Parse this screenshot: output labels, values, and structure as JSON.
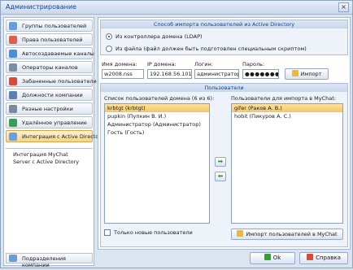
{
  "window": {
    "title": "Администрирование",
    "close_glyph": "×"
  },
  "sidebar": {
    "items": [
      {
        "label": "Группы пользователей",
        "icon": "users-group-icon",
        "color": "#6b9bd8"
      },
      {
        "label": "Права пользователей",
        "icon": "rights-icon",
        "color": "#e05c4b"
      },
      {
        "label": "Автосоздаваемые каналы",
        "icon": "channels-icon",
        "color": "#4a8fd6"
      },
      {
        "label": "Операторы каналов",
        "icon": "operators-icon",
        "color": "#7d8da6"
      },
      {
        "label": "Забаненные пользователи",
        "icon": "banned-icon",
        "color": "#d84a3a"
      },
      {
        "label": "Должности компании",
        "icon": "positions-icon",
        "color": "#5b7fb3"
      },
      {
        "label": "Разные настройки",
        "icon": "settings-icon",
        "color": "#7a8aa0"
      },
      {
        "label": "Удалённое управление",
        "icon": "remote-icon",
        "color": "#3d9c5a"
      },
      {
        "label": "Интеграция с Active Directory",
        "icon": "ad-icon",
        "color": "#6f9fd6"
      }
    ],
    "panel_text": "Интеграция MyChat Server с Active Directory",
    "footer_label": "Подразделения компании"
  },
  "import_method": {
    "title": "Способ импорта пользователей из Active Directory",
    "option1": "Из контроллера домена (LDAP)",
    "option2": "Из файла (файл должен быть подготовлен специальным скриптом)"
  },
  "connection": {
    "domain_label": "Имя домена:",
    "domain_value": "w2008.nss",
    "ip_label": "IP домена:",
    "ip_value": "192.168.56.101",
    "login_label": "Логин:",
    "login_value": "администратор",
    "password_label": "Пароль:",
    "password_value": "●●●●●●●",
    "import_button": "Импорт"
  },
  "users": {
    "title": "Пользователи",
    "domain_list_title": "Список пользователей домена (6 из 6):",
    "domain_users": [
      "krbtgt (krbtgt)",
      "pupkin (Пупкин В. И.)",
      "Администратор (Администратор)",
      "Гость (Гость)"
    ],
    "import_list_title": "Пользователи для импорта в MyChat:",
    "import_users": [
      "gifer (Раков А. В.)",
      "hobit (Пикуров А. С.)"
    ],
    "only_new_label": "Только новые пользователи",
    "import_mychat_button": "Импорт пользователей в MyChat",
    "arrow_right": "➡",
    "arrow_left": "⬅"
  },
  "footer": {
    "ok_label": "Ok",
    "help_label": "Справка"
  }
}
